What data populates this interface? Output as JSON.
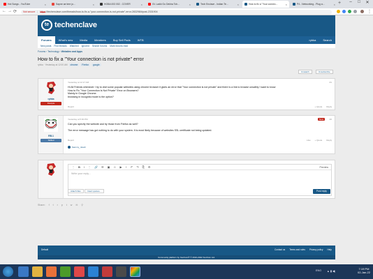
{
  "browser": {
    "tabs": [
      {
        "label": "Hot Songs - YouTube",
        "color": "#ff0000"
      },
      {
        "label": "Sapne ae tere jo...",
        "color": "#e8453c"
      },
      {
        "label": "HOBA 003 002 - COVER",
        "color": "#333333"
      },
      {
        "label": "Gt. Ladki Go Dekha Toh...",
        "color": "#ff0000"
      },
      {
        "label": "Tech Enclave - Indian Te...",
        "color": "#185886"
      },
      {
        "label": "How to fix a \"Your connec...",
        "color": "#185886"
      },
      {
        "label": "P4 - Networking - Plug a...",
        "color": "#185886"
      }
    ],
    "active_tab": 5,
    "not_secure_label": "Not secure",
    "url_scheme": "https",
    "url_rest": "://techenclave.com/threads/how-to-fix-a-\"your-connection-is-not-private\"-error.283298/#post-2331904"
  },
  "site": {
    "logo_mark": "te",
    "logo_text": "techenclave",
    "nav": [
      "Forums",
      "What's new",
      "Media",
      "Members",
      "Buy Sell Pads",
      "WTB"
    ],
    "nav_right": [
      "rybka",
      "Search"
    ],
    "subnav": [
      "New posts",
      "Find threads",
      "Watched",
      "Ignored",
      "Search forums",
      "Mark forums read"
    ],
    "breadcrumb": [
      "Forums",
      "Technology",
      "Websites and Apps"
    ],
    "title": "How to fix a \"Your connection is not private\" error",
    "meta_author": "rybka",
    "meta_date": "Yesterday at 12:00 AM",
    "tags": [
      "chrome",
      "Firefox",
      "google"
    ],
    "unwatch_label": "Unwatch",
    "subscribe_label": "Unsubscribe",
    "posts": [
      {
        "user": "rybka",
        "title": "Disciple",
        "title_color": "#c2281c",
        "date": "Yesterday at 12:17 AM",
        "num": "#1",
        "body": [
          "Hi All Friends whenever I try to visit some popular websites using chrome browser it gives an error that \"Your connection is not private\" and there is a link to browse unsafely I want to know",
          "How to Fix \"Your Connection Is Not Private\" Error on Browsers?",
          "Mainly in Google Chrome.",
          "browsing in incognito mode is the option?"
        ],
        "report": "Report",
        "quote": "+ Quote",
        "reply": "Reply"
      },
      {
        "user": "RB.1",
        "title": "Skilled",
        "title_color": "#4a79a8",
        "date": "Yesterday at 5:00 PM",
        "badge": "New",
        "num": "#2",
        "body": [
          "Can you specify the website and try those from Firefox as well?",
          "",
          "The error message has got nothing to do with your system. It is most likely because of websites SSL certificate not being updated."
        ],
        "report": "Report",
        "like": "Like",
        "quote": "+ Quote",
        "reply": "Reply",
        "likers": "Sammy_nitesh"
      }
    ],
    "editor_placeholder": "Write your reply...",
    "preview_label": "Preview",
    "attach_label": "Attach files",
    "insert_quotes_label": "Insert quotes...",
    "post_reply_label": "Post reply",
    "share_label": "Share:",
    "footer_default": "Default",
    "footer_links": [
      "Contact us",
      "Terms and rules",
      "Privacy policy",
      "Help"
    ],
    "copyright": "Community platform by XenForo® © 2010-2022 XenForo Ltd."
  },
  "taskbar": {
    "time": "7:19 PM",
    "date": "02-Jan-22",
    "lang": "ENG"
  }
}
